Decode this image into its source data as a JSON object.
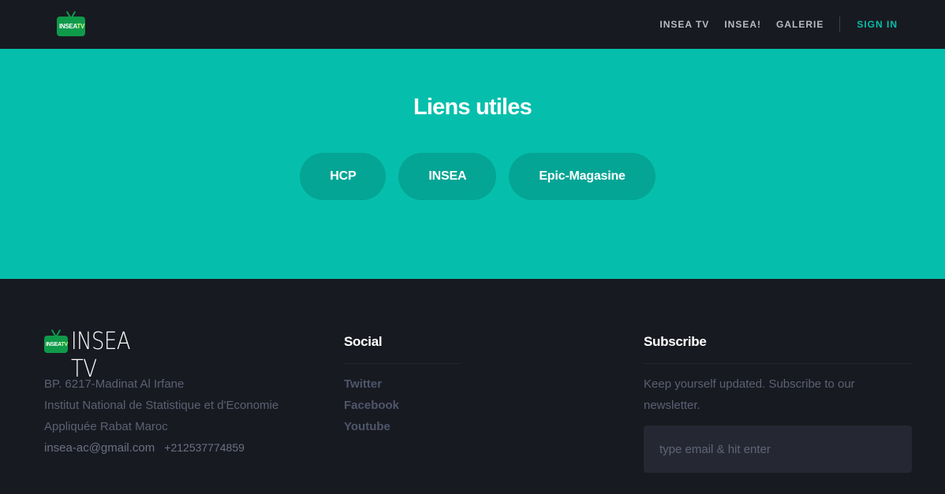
{
  "nav": {
    "logo_text_main": "INSEA",
    "logo_text_accent": "TV",
    "links": [
      "INSEA TV",
      "INSEA!",
      "GALERIE"
    ],
    "signin": "SIGN IN",
    "accent_color": "#06bfac"
  },
  "hero": {
    "title": "Liens utiles",
    "buttons": [
      "HCP",
      "INSEA",
      "Epic-Magasine"
    ],
    "background_color": "#05bfac"
  },
  "footer": {
    "brand": {
      "logo_text_main": "INSEA",
      "logo_text_accent": "TV",
      "wordmark": "INSEA TV"
    },
    "address_lines": [
      "BP. 6217-Madinat Al Irfane",
      "Institut National de Statistique et d'Economie",
      "Appliquée Rabat Maroc"
    ],
    "email": "insea-ac@gmail.com",
    "phone": "+212537774859",
    "social": {
      "title": "Social",
      "links": [
        "Twitter",
        "Facebook",
        "Youtube"
      ]
    },
    "subscribe": {
      "title": "Subscribe",
      "text": "Keep yourself updated. Subscribe to our newsletter.",
      "placeholder": "type email & hit enter"
    }
  }
}
